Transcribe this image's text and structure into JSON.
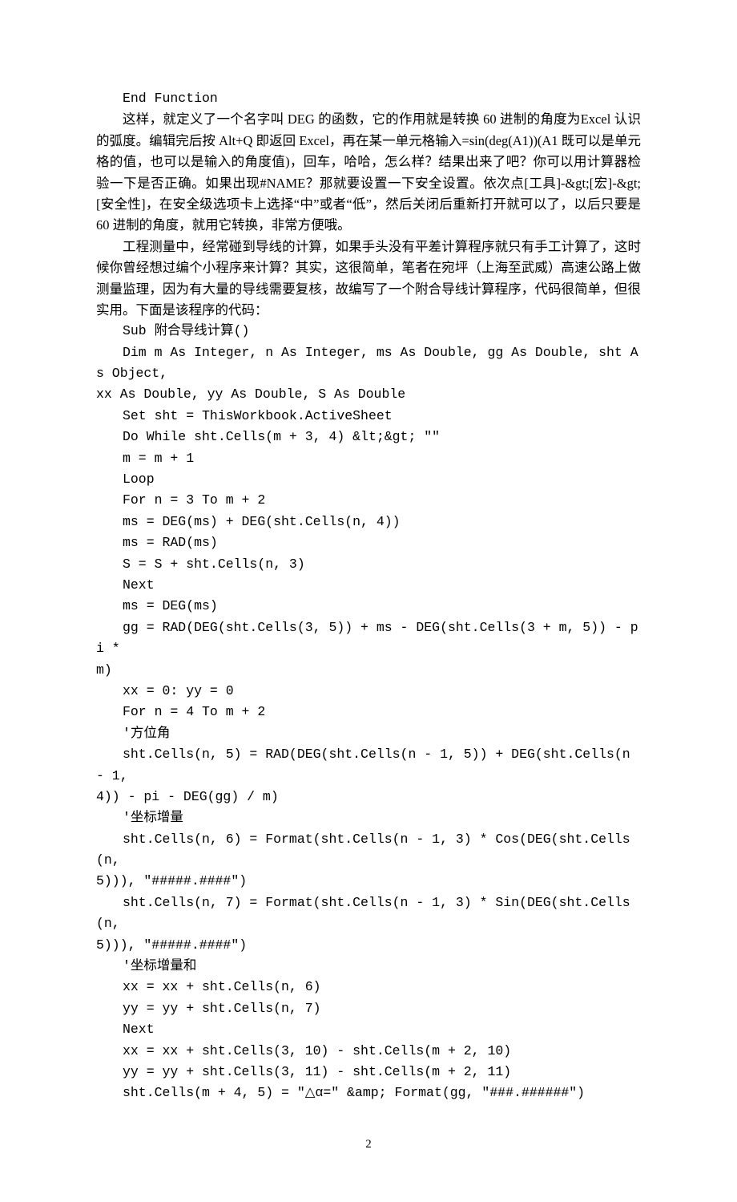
{
  "lines": [
    {
      "cls": "code-line",
      "t": "End Function"
    },
    {
      "cls": "para",
      "t": "这样，就定义了一个名字叫 DEG 的函数，它的作用就是转换 60 进制的角度为Excel 认识的弧度。编辑完后按 Alt+Q 即返回 Excel，再在某一单元格输入=sin(deg(A1))(A1 既可以是单元格的值，也可以是输入的角度值)，回车，哈哈，怎么样？结果出来了吧？你可以用计算器检验一下是否正确。如果出现#NAME？那就要设置一下安全设置。依次点[工具]-&gt;[宏]-&gt;[安全性]，在安全级选项卡上选择“中”或者“低”，然后关闭后重新打开就可以了，以后只要是 60 进制的角度，就用它转换，非常方便哦。"
    },
    {
      "cls": "para",
      "t": "工程测量中，经常碰到导线的计算，如果手头没有平差计算程序就只有手工计算了，这时候你曾经想过编个小程序来计算？其实，这很简单，笔者在宛坪（上海至武威）高速公路上做测量监理，因为有大量的导线需要复核，故编写了一个附合导线计算程序，代码很简单，但很实用。下面是该程序的代码："
    },
    {
      "cls": "code-line",
      "t": "Sub 附合导线计算()"
    },
    {
      "cls": "code-line",
      "t": "Dim m As Integer, n As Integer, ms As Double, gg As Double, sht As Object,"
    },
    {
      "cls": "code-cont",
      "t": "xx As Double, yy As Double, S As Double"
    },
    {
      "cls": "code-line",
      "t": "Set sht = ThisWorkbook.ActiveSheet"
    },
    {
      "cls": "code-line",
      "t": "Do While sht.Cells(m + 3, 4) &lt;&gt; \"\""
    },
    {
      "cls": "code-line",
      "t": "m = m + 1"
    },
    {
      "cls": "code-line",
      "t": "Loop"
    },
    {
      "cls": "code-line",
      "t": "For n = 3 To m + 2"
    },
    {
      "cls": "code-line",
      "t": "ms = DEG(ms) + DEG(sht.Cells(n, 4))"
    },
    {
      "cls": "code-line",
      "t": "ms = RAD(ms)"
    },
    {
      "cls": "code-line",
      "t": "S = S + sht.Cells(n, 3)"
    },
    {
      "cls": "code-line",
      "t": "Next"
    },
    {
      "cls": "code-line",
      "t": "ms = DEG(ms)"
    },
    {
      "cls": "code-line",
      "t": "gg = RAD(DEG(sht.Cells(3, 5)) + ms - DEG(sht.Cells(3 + m, 5)) - pi *"
    },
    {
      "cls": "code-cont",
      "t": "m)"
    },
    {
      "cls": "code-line",
      "t": "xx = 0: yy = 0"
    },
    {
      "cls": "code-line",
      "t": "For n = 4 To m + 2"
    },
    {
      "cls": "code-line",
      "t": "'方位角"
    },
    {
      "cls": "code-line",
      "t": "sht.Cells(n, 5) = RAD(DEG(sht.Cells(n - 1, 5)) + DEG(sht.Cells(n - 1,"
    },
    {
      "cls": "code-cont",
      "t": "4)) - pi - DEG(gg) / m)"
    },
    {
      "cls": "code-line",
      "t": "'坐标增量"
    },
    {
      "cls": "code-line",
      "t": "sht.Cells(n, 6) = Format(sht.Cells(n - 1, 3) * Cos(DEG(sht.Cells(n,"
    },
    {
      "cls": "code-cont",
      "t": "5))), \"#####.####\")"
    },
    {
      "cls": "code-line",
      "t": "sht.Cells(n, 7) = Format(sht.Cells(n - 1, 3) * Sin(DEG(sht.Cells(n,"
    },
    {
      "cls": "code-cont",
      "t": "5))), \"#####.####\")"
    },
    {
      "cls": "code-line",
      "t": "'坐标增量和"
    },
    {
      "cls": "code-line",
      "t": "xx = xx + sht.Cells(n, 6)"
    },
    {
      "cls": "code-line",
      "t": "yy = yy + sht.Cells(n, 7)"
    },
    {
      "cls": "code-line",
      "t": "Next"
    },
    {
      "cls": "code-line",
      "t": "xx = xx + sht.Cells(3, 10) - sht.Cells(m + 2, 10)"
    },
    {
      "cls": "code-line",
      "t": "yy = yy + sht.Cells(3, 11) - sht.Cells(m + 2, 11)"
    },
    {
      "cls": "code-line",
      "t": "sht.Cells(m + 4, 5) = \"△α=\" &amp; Format(gg, \"###.######\")"
    }
  ],
  "pageNumber": "2"
}
